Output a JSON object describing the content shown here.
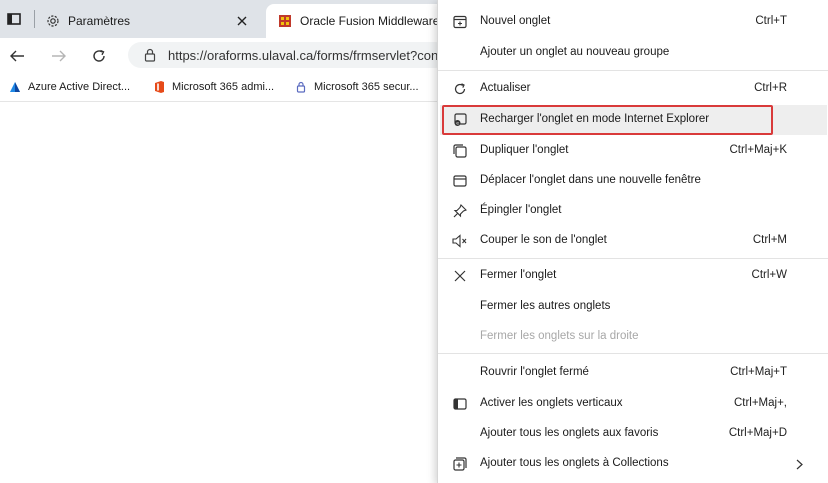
{
  "tabs": {
    "settings_label": "Paramètres",
    "active_label": "Oracle Fusion Middleware Forms Services"
  },
  "address": {
    "url": "https://oraforms.ulaval.ca/forms/frmservlet?config"
  },
  "bookmarks": [
    {
      "label": "Azure Active Direct..."
    },
    {
      "label": "Microsoft 365 admi..."
    },
    {
      "label": "Microsoft 365 secur..."
    }
  ],
  "menu": {
    "items": [
      {
        "label": "Nouvel onglet",
        "shortcut": "Ctrl+T"
      },
      {
        "label": "Ajouter un onglet au nouveau groupe",
        "shortcut": ""
      },
      {
        "label": "Actualiser",
        "shortcut": "Ctrl+R"
      },
      {
        "label": "Recharger l'onglet en mode Internet Explorer",
        "shortcut": ""
      },
      {
        "label": "Dupliquer l'onglet",
        "shortcut": "Ctrl+Maj+K"
      },
      {
        "label": "Déplacer l'onglet dans une nouvelle fenêtre",
        "shortcut": ""
      },
      {
        "label": "Épingler l'onglet",
        "shortcut": ""
      },
      {
        "label": "Couper le son de l'onglet",
        "shortcut": "Ctrl+M"
      },
      {
        "label": "Fermer l'onglet",
        "shortcut": "Ctrl+W"
      },
      {
        "label": "Fermer les autres onglets",
        "shortcut": ""
      },
      {
        "label": "Fermer les onglets sur la droite",
        "shortcut": ""
      },
      {
        "label": "Rouvrir l'onglet fermé",
        "shortcut": "Ctrl+Maj+T"
      },
      {
        "label": "Activer les onglets verticaux",
        "shortcut": "Ctrl+Maj+,"
      },
      {
        "label": "Ajouter tous les onglets aux favoris",
        "shortcut": "Ctrl+Maj+D"
      },
      {
        "label": "Ajouter tous les onglets à Collections",
        "shortcut": ""
      }
    ]
  },
  "colors": {
    "tabstrip_bg": "#dfe3e8",
    "highlight_outline": "#d93a3a",
    "disabled_text": "#a7a7a7"
  }
}
